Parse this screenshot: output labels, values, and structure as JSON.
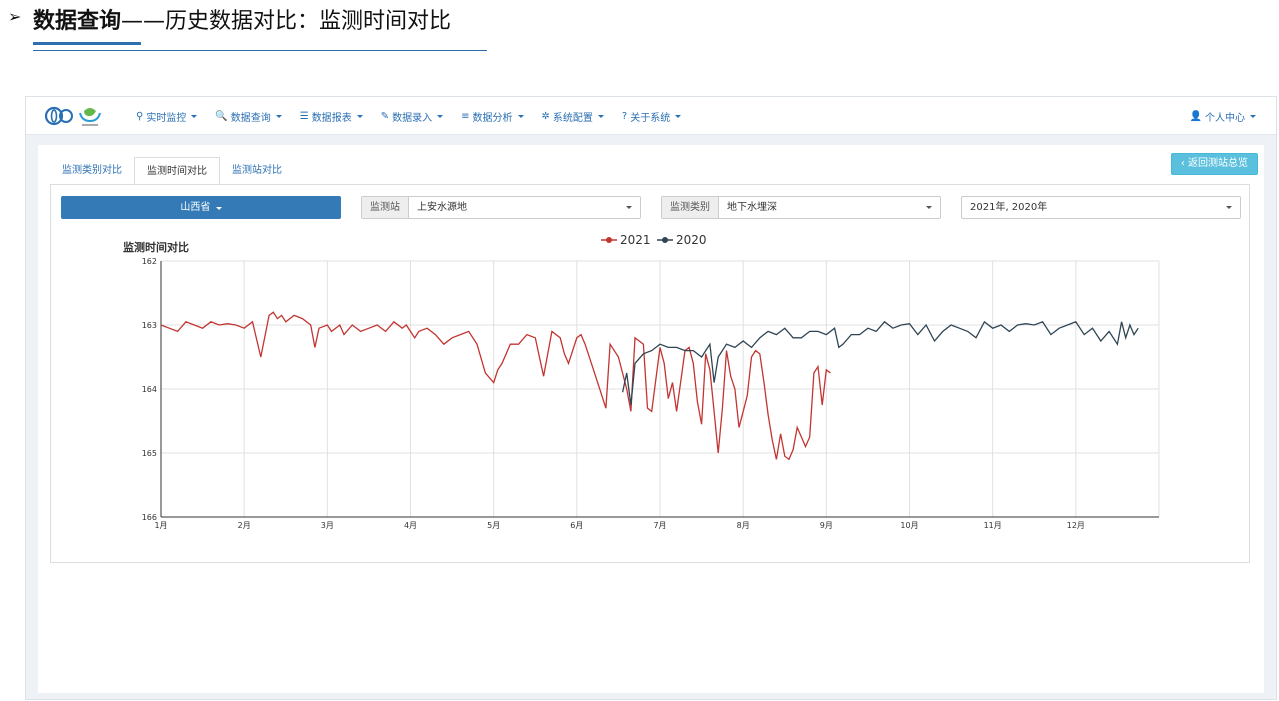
{
  "header": {
    "title_bold": "数据查询",
    "title_rest": "——历史数据对比：监测时间对比"
  },
  "navbar": {
    "items": [
      {
        "label": "实时监控",
        "icon": "map-marker-icon",
        "glyph": "⚲"
      },
      {
        "label": "数据查询",
        "icon": "search-icon",
        "glyph": "🔍"
      },
      {
        "label": "数据报表",
        "icon": "list-icon",
        "glyph": "☰"
      },
      {
        "label": "数据录入",
        "icon": "edit-icon",
        "glyph": "✎"
      },
      {
        "label": "数据分析",
        "icon": "tasks-icon",
        "glyph": "≡"
      },
      {
        "label": "系统配置",
        "icon": "cog-icon",
        "glyph": "✲"
      },
      {
        "label": "关于系统",
        "icon": "question-circle-icon",
        "glyph": "?"
      }
    ],
    "user_menu": "个人中心"
  },
  "tabs": [
    "监测类别对比",
    "监测时间对比",
    "监测站对比"
  ],
  "active_tab": 1,
  "back_button": "返回测站总览",
  "filters": {
    "province": "山西省",
    "station_label": "监测站",
    "station_value": "上安水源地",
    "category_label": "监测类别",
    "category_value": "地下水埋深",
    "years_value": "2021年, 2020年"
  },
  "colors": {
    "series_2021": "#c23531",
    "series_2020": "#2f4554",
    "primary": "#337ab7",
    "info": "#5bc0de"
  },
  "chart_data": {
    "type": "line",
    "title": "监测时间对比",
    "xlabel": "",
    "ylabel": "",
    "x_ticks": [
      "1月",
      "2月",
      "3月",
      "4月",
      "5月",
      "6月",
      "7月",
      "8月",
      "9月",
      "10月",
      "11月",
      "12月"
    ],
    "ylim": [
      162,
      166
    ],
    "y_ticks": [
      162,
      163,
      164,
      165,
      166
    ],
    "y_inverted": true,
    "legend_position": "top-center",
    "grid": true,
    "series": [
      {
        "name": "2021",
        "x_months": [
          0,
          0.1,
          0.2,
          0.3,
          0.4,
          0.5,
          0.6,
          0.7,
          0.8,
          0.9,
          1.0,
          1.1,
          1.2,
          1.3,
          1.35,
          1.4,
          1.45,
          1.5,
          1.6,
          1.7,
          1.8,
          1.85,
          1.9,
          2.0,
          2.05,
          2.1,
          2.15,
          2.2,
          2.3,
          2.4,
          2.5,
          2.6,
          2.7,
          2.8,
          2.9,
          2.95,
          3.0,
          3.05,
          3.1,
          3.2,
          3.3,
          3.4,
          3.5,
          3.6,
          3.7,
          3.8,
          3.9,
          4.0,
          4.05,
          4.1,
          4.2,
          4.3,
          4.4,
          4.5,
          4.55,
          4.6,
          4.7,
          4.8,
          4.85,
          4.9,
          5.0,
          5.05,
          5.1,
          5.2,
          5.3,
          5.35,
          5.4,
          5.5,
          5.6,
          5.65,
          5.7,
          5.8,
          5.85,
          5.9,
          6.0,
          6.05,
          6.1,
          6.15,
          6.2,
          6.3,
          6.35,
          6.4,
          6.45,
          6.5,
          6.55,
          6.6,
          6.65,
          6.7,
          6.75,
          6.8,
          6.85,
          6.9,
          6.95,
          7.0,
          7.05,
          7.1,
          7.15,
          7.2,
          7.25,
          7.3,
          7.35,
          7.4,
          7.45,
          7.5,
          7.55,
          7.6,
          7.65,
          7.7,
          7.75,
          7.8,
          7.85,
          7.9,
          7.95,
          8.0,
          8.05
        ],
        "values": [
          163.0,
          163.05,
          163.1,
          162.95,
          163.0,
          163.05,
          162.95,
          163.0,
          162.98,
          163.0,
          163.05,
          162.95,
          163.5,
          162.85,
          162.8,
          162.9,
          162.85,
          162.95,
          162.85,
          162.9,
          163.0,
          163.35,
          163.05,
          163.0,
          163.1,
          163.05,
          163.0,
          163.15,
          163.0,
          163.1,
          163.05,
          163.0,
          163.1,
          162.95,
          163.05,
          163.0,
          163.1,
          163.2,
          163.1,
          163.05,
          163.15,
          163.3,
          163.2,
          163.15,
          163.1,
          163.3,
          163.75,
          163.9,
          163.7,
          163.6,
          163.3,
          163.3,
          163.15,
          163.2,
          163.5,
          163.8,
          163.1,
          163.2,
          163.45,
          163.6,
          163.2,
          163.15,
          163.3,
          163.7,
          164.1,
          164.3,
          163.3,
          163.5,
          164.0,
          164.35,
          163.2,
          163.3,
          164.3,
          164.35,
          163.35,
          163.6,
          164.15,
          163.9,
          164.35,
          163.4,
          163.35,
          163.6,
          164.2,
          164.55,
          163.45,
          163.7,
          164.35,
          165.0,
          164.3,
          163.4,
          163.8,
          164.0,
          164.6,
          164.35,
          164.1,
          163.5,
          163.4,
          163.45,
          163.9,
          164.4,
          164.8,
          165.1,
          164.7,
          165.05,
          165.1,
          164.95,
          164.6,
          164.75,
          164.9,
          164.75,
          163.75,
          163.65,
          164.25,
          163.7,
          163.75
        ]
      },
      {
        "name": "2020",
        "x_months": [
          5.55,
          5.6,
          5.65,
          5.7,
          5.8,
          5.9,
          6.0,
          6.1,
          6.2,
          6.3,
          6.4,
          6.5,
          6.6,
          6.65,
          6.7,
          6.8,
          6.9,
          7.0,
          7.05,
          7.1,
          7.2,
          7.3,
          7.4,
          7.5,
          7.6,
          7.7,
          7.8,
          7.9,
          8.0,
          8.1,
          8.15,
          8.2,
          8.3,
          8.4,
          8.5,
          8.6,
          8.7,
          8.8,
          8.9,
          9.0,
          9.1,
          9.2,
          9.3,
          9.4,
          9.5,
          9.6,
          9.7,
          9.8,
          9.9,
          10.0,
          10.1,
          10.2,
          10.3,
          10.4,
          10.5,
          10.6,
          10.7,
          10.8,
          10.9,
          11.0,
          11.1,
          11.2,
          11.3,
          11.4,
          11.5,
          11.55,
          11.6,
          11.65,
          11.7,
          11.75
        ],
        "values": [
          164.05,
          163.75,
          164.25,
          163.6,
          163.45,
          163.4,
          163.3,
          163.35,
          163.35,
          163.4,
          163.4,
          163.5,
          163.3,
          163.9,
          163.5,
          163.3,
          163.35,
          163.25,
          163.3,
          163.35,
          163.2,
          163.1,
          163.15,
          163.05,
          163.2,
          163.2,
          163.1,
          163.1,
          163.15,
          163.05,
          163.35,
          163.3,
          163.15,
          163.15,
          163.05,
          163.1,
          162.95,
          163.05,
          163.0,
          162.98,
          163.15,
          163.0,
          163.25,
          163.1,
          163.0,
          163.05,
          163.1,
          163.2,
          162.95,
          163.05,
          163.0,
          163.1,
          163.0,
          162.98,
          163.0,
          162.95,
          163.15,
          163.05,
          163.0,
          162.95,
          163.15,
          163.05,
          163.25,
          163.1,
          163.3,
          162.95,
          163.2,
          163.0,
          163.15,
          163.05
        ]
      }
    ]
  }
}
